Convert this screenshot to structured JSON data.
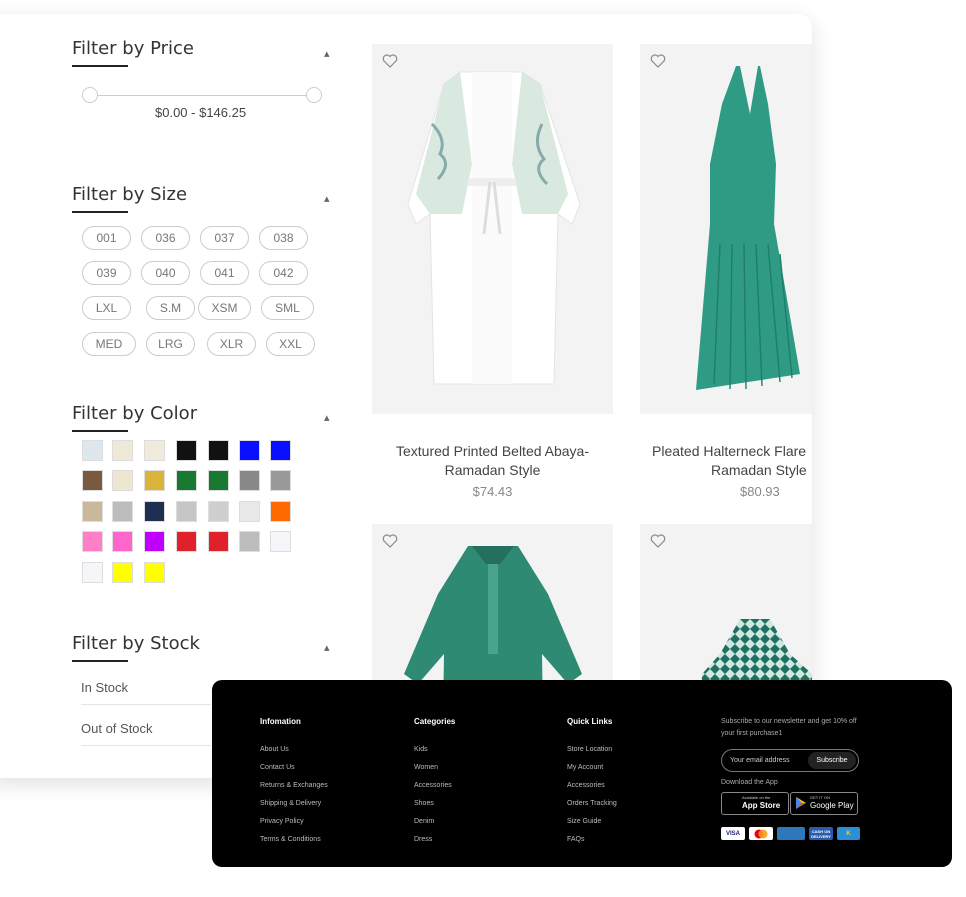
{
  "filters": {
    "price": {
      "title": "Filter by Price",
      "range": "$0.00 - $146.25"
    },
    "size": {
      "title": "Filter by Size",
      "rows": [
        [
          "001",
          "036",
          "037",
          "038"
        ],
        [
          "039",
          "040",
          "041",
          "042"
        ],
        [
          "LXL",
          "S.M",
          "XSM",
          "SML"
        ],
        [
          "MED",
          "LRG",
          "XLR",
          "XXL"
        ]
      ]
    },
    "color": {
      "title": "Filter by Color",
      "colors": [
        "#dce8ee",
        "#efe8d6",
        "#f0ebdc",
        "#111111",
        "#111111",
        "#0a10ff",
        "#0a10ff",
        "#7a5a3e",
        "#efe6cf",
        "#d9b33a",
        "#177a30",
        "#177a30",
        "#888888",
        "#999999",
        "#c9b89c",
        "#bcbcbc",
        "#1e2f4f",
        "#c6c6c6",
        "#cfcfcf",
        "#e8e8e8",
        "#ff6a00",
        "#ff7ec8",
        "#ff66cc",
        "#c000ff",
        "#e0202a",
        "#e0202a",
        "#bdbdbd",
        "#f6f6fa",
        "#f6f6fa",
        "#ffff00",
        "#ffff00"
      ]
    },
    "stock": {
      "title": "Filter by Stock",
      "options": [
        "In Stock",
        "Out of Stock"
      ]
    }
  },
  "products": [
    {
      "name_line1": "Textured Printed Belted Abaya-",
      "name_line2": "Ramadan Style",
      "price": "$74.43"
    },
    {
      "name_line1": "Pleated Halterneck Flare",
      "name_line2": "Ramadan Style",
      "price": "$80.93"
    },
    {
      "name_line1": "",
      "name_line2": "",
      "price": ""
    },
    {
      "name_line1": "",
      "name_line2": "",
      "price": ""
    }
  ],
  "footer": {
    "info": {
      "title": "Infomation",
      "links": [
        "About Us",
        "Contact Us",
        "Returns & Exchanges",
        "Shipping & Delivery",
        "Privacy Policy",
        "Terms & Conditions"
      ]
    },
    "categories": {
      "title": "Categories",
      "links": [
        "Kids",
        "Women",
        "Accessories",
        "Shoes",
        "Denim",
        "Dress"
      ]
    },
    "quick": {
      "title": "Quick Links",
      "links": [
        "Store Location",
        "My Account",
        "Accessories",
        "Orders Tracking",
        "Size Guide",
        "FAQs"
      ]
    },
    "newsletter": {
      "text": "Subscribe to our newsletter and get 10% off your first purchase1",
      "placeholder": "Your email address",
      "button": "Subscribe",
      "download": "Download the App",
      "appstore_small": "Available on the",
      "appstore": "App Store",
      "googleplay_small": "GET IT ON",
      "googleplay": "Google Play"
    },
    "payments": [
      "VISA",
      "",
      "",
      "CASH ON DELIVERY",
      "K"
    ]
  }
}
